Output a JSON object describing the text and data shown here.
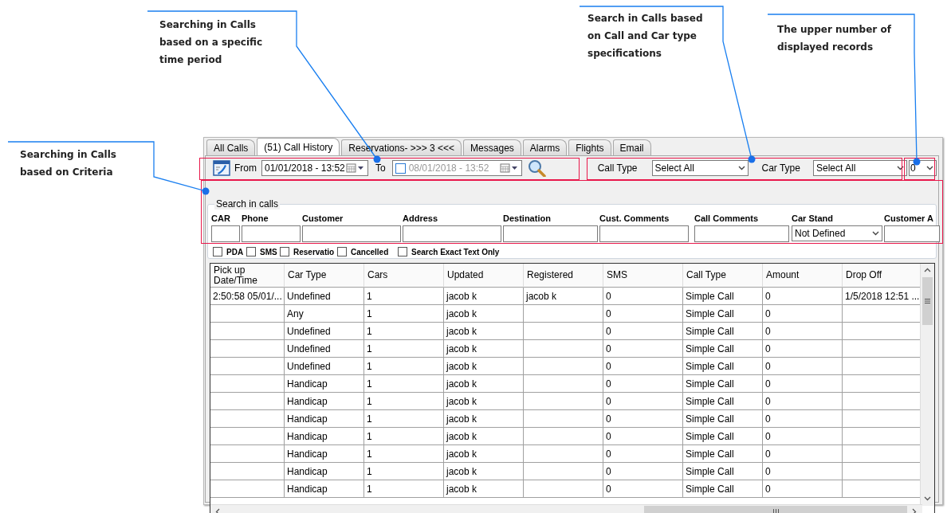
{
  "callouts": [
    {
      "text": "Searching in Calls\nbased on a specific\ntime period"
    },
    {
      "text": "Search in Calls based\non  Call and Car type\nspecifications"
    },
    {
      "text": "The upper number of\ndisplayed records"
    },
    {
      "text": "Searching in Calls\nbased on Criteria"
    }
  ],
  "tabs": [
    {
      "label": "All Calls",
      "selected": false
    },
    {
      "label": "(51) Call History",
      "selected": true
    },
    {
      "label": "Reservations- >>> 3 <<<",
      "selected": false
    },
    {
      "label": "Messages",
      "selected": false
    },
    {
      "label": "Alarms",
      "selected": false
    },
    {
      "label": "Flights",
      "selected": false
    },
    {
      "label": "Email",
      "selected": false
    }
  ],
  "date_filter": {
    "from_label": "From",
    "from_value": "01/01/2018 - 13:52",
    "to_label": "To",
    "to_checked": false,
    "to_value": "08/01/2018 - 13:52"
  },
  "type_filter": {
    "call_type_label": "Call Type",
    "call_type_value": "Select All",
    "car_type_label": "Car Type",
    "car_type_value": "Select All",
    "record_limit": "0"
  },
  "search": {
    "title": "Search in calls",
    "fields": [
      {
        "label": "CAR",
        "kind": "text"
      },
      {
        "label": "Phone",
        "kind": "text"
      },
      {
        "label": "Customer",
        "kind": "text"
      },
      {
        "label": "Address",
        "kind": "text"
      },
      {
        "label": "Destination",
        "kind": "text"
      },
      {
        "label": "Cust. Comments",
        "kind": "text"
      },
      {
        "label": "Call Comments",
        "kind": "text"
      },
      {
        "label": "Car Stand",
        "kind": "dropdown",
        "value": "Not Defined"
      },
      {
        "label": "Customer A",
        "kind": "text"
      }
    ],
    "checkboxes": [
      {
        "label": "PDA",
        "checked": false
      },
      {
        "label": "SMS",
        "checked": false
      },
      {
        "label": "Reservatio",
        "checked": false
      },
      {
        "label": "Cancelled",
        "checked": false
      },
      {
        "label": "Search Exact Text Only",
        "checked": false
      }
    ]
  },
  "table": {
    "columns": [
      {
        "label": "Pick up\nDate/Time"
      },
      {
        "label": "Car Type"
      },
      {
        "label": "Cars"
      },
      {
        "label": "Updated"
      },
      {
        "label": "Registered"
      },
      {
        "label": "SMS"
      },
      {
        "label": "Call Type"
      },
      {
        "label": "Amount"
      },
      {
        "label": "Drop Off"
      }
    ],
    "rows": [
      {
        "pickup": "2:50:58 05/01/...",
        "car_type": "Undefined",
        "cars": "1",
        "updated": "jacob k",
        "registered": "jacob k",
        "sms": "0",
        "call_type": "Simple Call",
        "amount": "0",
        "drop_off": "1/5/2018 12:51 ..."
      },
      {
        "car_type": "Any",
        "cars": "1",
        "updated": "jacob k",
        "sms": "0",
        "call_type": "Simple Call",
        "amount": "0"
      },
      {
        "car_type": "Undefined",
        "cars": "1",
        "updated": "jacob k",
        "sms": "0",
        "call_type": "Simple Call",
        "amount": "0"
      },
      {
        "car_type": "Undefined",
        "cars": "1",
        "updated": "jacob k",
        "sms": "0",
        "call_type": "Simple Call",
        "amount": "0"
      },
      {
        "car_type": "Undefined",
        "cars": "1",
        "updated": "jacob k",
        "sms": "0",
        "call_type": "Simple Call",
        "amount": "0"
      },
      {
        "car_type": "Handicap",
        "cars": "1",
        "updated": "jacob k",
        "sms": "0",
        "call_type": "Simple Call",
        "amount": "0"
      },
      {
        "car_type": "Handicap",
        "cars": "1",
        "updated": "jacob k",
        "sms": "0",
        "call_type": "Simple Call",
        "amount": "0"
      },
      {
        "car_type": "Handicap",
        "cars": "1",
        "updated": "jacob k",
        "sms": "0",
        "call_type": "Simple Call",
        "amount": "0"
      },
      {
        "car_type": "Handicap",
        "cars": "1",
        "updated": "jacob k",
        "sms": "0",
        "call_type": "Simple Call",
        "amount": "0"
      },
      {
        "car_type": "Handicap",
        "cars": "1",
        "updated": "jacob k",
        "sms": "0",
        "call_type": "Simple Call",
        "amount": "0"
      },
      {
        "car_type": "Handicap",
        "cars": "1",
        "updated": "jacob k",
        "sms": "0",
        "call_type": "Simple Call",
        "amount": "0"
      },
      {
        "car_type": "Handicap",
        "cars": "1",
        "updated": "jacob k",
        "sms": "0",
        "call_type": "Simple Call",
        "amount": "0"
      }
    ]
  }
}
